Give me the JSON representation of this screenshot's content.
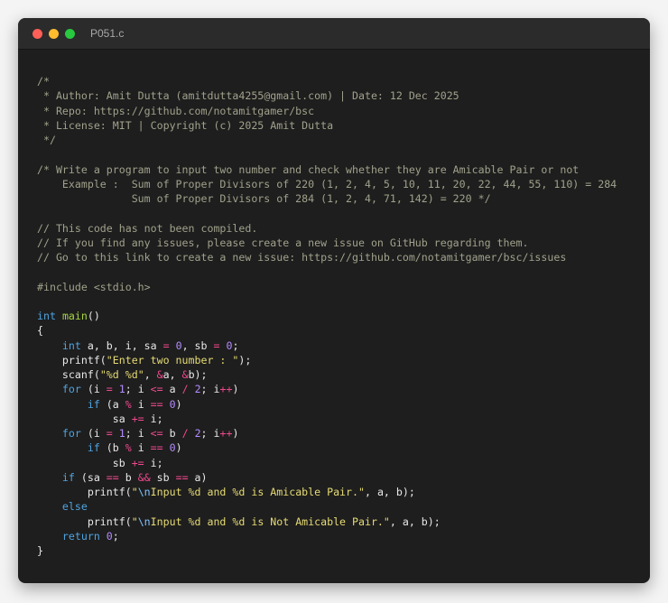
{
  "window": {
    "title": "P051.c",
    "colors": {
      "background": "#1e1e1e",
      "titlebar": "#2b2b2b",
      "close": "#ff5f57",
      "minimize": "#febc2e",
      "maximize": "#28c840"
    }
  },
  "code": {
    "lines": [
      [
        [
          "c",
          "/*"
        ]
      ],
      [
        [
          "c",
          " * Author: Amit Dutta (amitdutta4255@gmail.com) | Date: 12 Dec 2025"
        ]
      ],
      [
        [
          "c",
          " * Repo: https://github.com/notamitgamer/bsc"
        ]
      ],
      [
        [
          "c",
          " * License: MIT | Copyright (c) 2025 Amit Dutta"
        ]
      ],
      [
        [
          "c",
          " */"
        ]
      ],
      [],
      [
        [
          "c",
          "/* Write a program to input two number and check whether they are Amicable Pair or not"
        ]
      ],
      [
        [
          "c",
          "    Example :  Sum of Proper Divisors of 220 (1, 2, 4, 5, 10, 11, 20, 22, 44, 55, 110) = 284"
        ]
      ],
      [
        [
          "c",
          "               Sum of Proper Divisors of 284 (1, 2, 4, 71, 142) = 220 */"
        ]
      ],
      [],
      [
        [
          "c",
          "// This code has not been compiled."
        ]
      ],
      [
        [
          "c",
          "// If you find any issues, please create a new issue on GitHub regarding them."
        ]
      ],
      [
        [
          "c",
          "// Go to this link to create a new issue: https://github.com/notamitgamer/bsc/issues"
        ]
      ],
      [],
      [
        [
          "pp",
          "#include <stdio.h>"
        ]
      ],
      [],
      [
        [
          "kw",
          "int"
        ],
        [
          "pl",
          " "
        ],
        [
          "fn",
          "main"
        ],
        [
          "pl",
          "()"
        ]
      ],
      [
        [
          "pl",
          "{"
        ]
      ],
      [
        [
          "pl",
          "    "
        ],
        [
          "kw",
          "int"
        ],
        [
          "pl",
          " a, b, i, sa "
        ],
        [
          "op",
          "="
        ],
        [
          "pl",
          " "
        ],
        [
          "num",
          "0"
        ],
        [
          "pl",
          ", sb "
        ],
        [
          "op",
          "="
        ],
        [
          "pl",
          " "
        ],
        [
          "num",
          "0"
        ],
        [
          "pl",
          ";"
        ]
      ],
      [
        [
          "pl",
          "    printf("
        ],
        [
          "str",
          "\"Enter two number : \""
        ],
        [
          "pl",
          ");"
        ]
      ],
      [
        [
          "pl",
          "    scanf("
        ],
        [
          "str",
          "\"%d %d\""
        ],
        [
          "pl",
          ", "
        ],
        [
          "op",
          "&"
        ],
        [
          "pl",
          "a, "
        ],
        [
          "op",
          "&"
        ],
        [
          "pl",
          "b);"
        ]
      ],
      [
        [
          "pl",
          "    "
        ],
        [
          "kw",
          "for"
        ],
        [
          "pl",
          " (i "
        ],
        [
          "op",
          "="
        ],
        [
          "pl",
          " "
        ],
        [
          "num",
          "1"
        ],
        [
          "pl",
          "; i "
        ],
        [
          "op",
          "<="
        ],
        [
          "pl",
          " a "
        ],
        [
          "op",
          "/"
        ],
        [
          "pl",
          " "
        ],
        [
          "num",
          "2"
        ],
        [
          "pl",
          "; i"
        ],
        [
          "op",
          "++"
        ],
        [
          "pl",
          ")"
        ]
      ],
      [
        [
          "pl",
          "        "
        ],
        [
          "kw",
          "if"
        ],
        [
          "pl",
          " (a "
        ],
        [
          "op",
          "%"
        ],
        [
          "pl",
          " i "
        ],
        [
          "op",
          "=="
        ],
        [
          "pl",
          " "
        ],
        [
          "num",
          "0"
        ],
        [
          "pl",
          ")"
        ]
      ],
      [
        [
          "pl",
          "            sa "
        ],
        [
          "op",
          "+="
        ],
        [
          "pl",
          " i;"
        ]
      ],
      [
        [
          "pl",
          "    "
        ],
        [
          "kw",
          "for"
        ],
        [
          "pl",
          " (i "
        ],
        [
          "op",
          "="
        ],
        [
          "pl",
          " "
        ],
        [
          "num",
          "1"
        ],
        [
          "pl",
          "; i "
        ],
        [
          "op",
          "<="
        ],
        [
          "pl",
          " b "
        ],
        [
          "op",
          "/"
        ],
        [
          "pl",
          " "
        ],
        [
          "num",
          "2"
        ],
        [
          "pl",
          "; i"
        ],
        [
          "op",
          "++"
        ],
        [
          "pl",
          ")"
        ]
      ],
      [
        [
          "pl",
          "        "
        ],
        [
          "kw",
          "if"
        ],
        [
          "pl",
          " (b "
        ],
        [
          "op",
          "%"
        ],
        [
          "pl",
          " i "
        ],
        [
          "op",
          "=="
        ],
        [
          "pl",
          " "
        ],
        [
          "num",
          "0"
        ],
        [
          "pl",
          ")"
        ]
      ],
      [
        [
          "pl",
          "            sb "
        ],
        [
          "op",
          "+="
        ],
        [
          "pl",
          " i;"
        ]
      ],
      [
        [
          "pl",
          "    "
        ],
        [
          "kw",
          "if"
        ],
        [
          "pl",
          " (sa "
        ],
        [
          "op",
          "=="
        ],
        [
          "pl",
          " b "
        ],
        [
          "op",
          "&&"
        ],
        [
          "pl",
          " sb "
        ],
        [
          "op",
          "=="
        ],
        [
          "pl",
          " a)"
        ]
      ],
      [
        [
          "pl",
          "        printf("
        ],
        [
          "str",
          "\""
        ],
        [
          "esc",
          "\\n"
        ],
        [
          "str",
          "Input %d and %d is Amicable Pair.\""
        ],
        [
          "pl",
          ", a, b);"
        ]
      ],
      [
        [
          "pl",
          "    "
        ],
        [
          "kw",
          "else"
        ]
      ],
      [
        [
          "pl",
          "        printf("
        ],
        [
          "str",
          "\""
        ],
        [
          "esc",
          "\\n"
        ],
        [
          "str",
          "Input %d and %d is Not Amicable Pair.\""
        ],
        [
          "pl",
          ", a, b);"
        ]
      ],
      [
        [
          "pl",
          "    "
        ],
        [
          "kw",
          "return"
        ],
        [
          "pl",
          " "
        ],
        [
          "num",
          "0"
        ],
        [
          "pl",
          ";"
        ]
      ],
      [
        [
          "pl",
          "}"
        ]
      ]
    ]
  }
}
